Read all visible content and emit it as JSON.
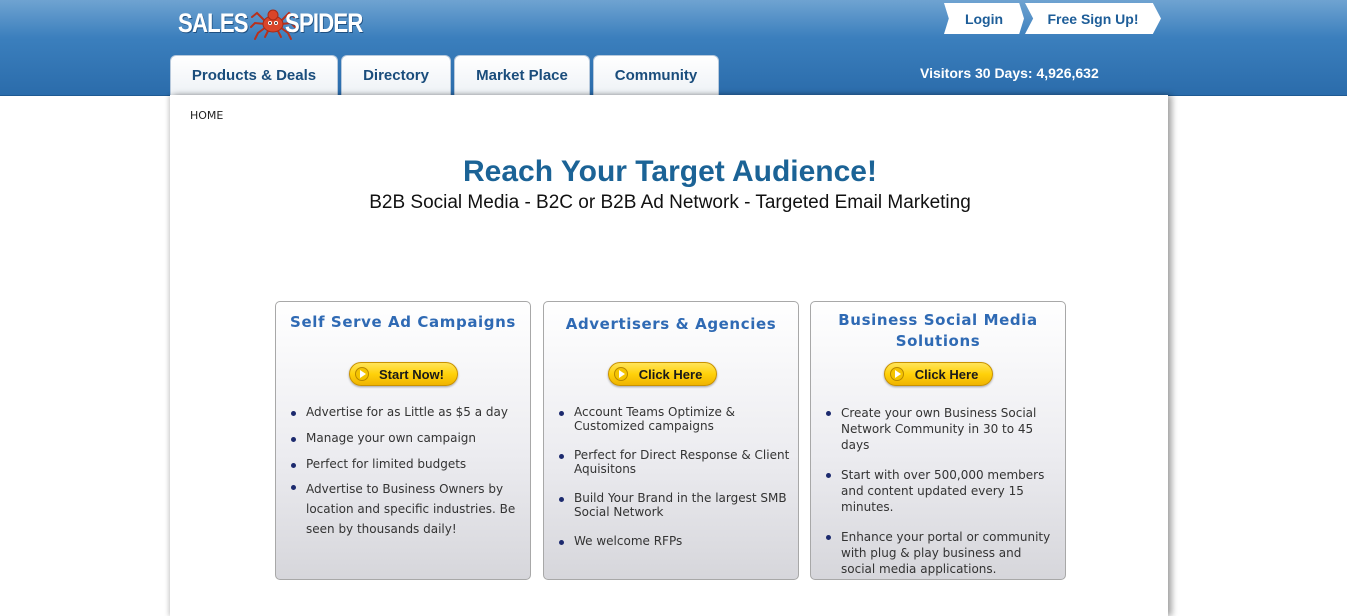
{
  "header": {
    "logo_left": "SALES",
    "logo_right": "SPIDER",
    "login_label": "Login",
    "signup_label": "Free Sign Up!",
    "visitors_text": "Visitors 30 Days: 4,926,632"
  },
  "nav": {
    "tabs": [
      {
        "label": "Products & Deals"
      },
      {
        "label": "Directory"
      },
      {
        "label": "Market Place"
      },
      {
        "label": "Community"
      }
    ]
  },
  "breadcrumb": "HOME",
  "hero": {
    "headline": "Reach Your Target Audience!",
    "subheadline": "B2B Social Media - B2C or B2B Ad Network - Targeted Email Marketing"
  },
  "cards": [
    {
      "title": "Self Serve Ad Campaigns",
      "button_label": "Start Now!",
      "items": [
        "Advertise for as Little as $5 a day",
        "Manage your own campaign",
        "Perfect for limited budgets",
        "Advertise to Business Owners by location and specific industries. Be seen by thousands daily!"
      ]
    },
    {
      "title": "Advertisers & Agencies",
      "button_label": "Click Here",
      "items": [
        "Account Teams Optimize & Customized campaigns",
        "Perfect for Direct Response & Client Aquisitons",
        "Build Your Brand in the largest SMB Social Network",
        "We welcome RFPs"
      ]
    },
    {
      "title": "Business Social Media Solutions",
      "button_label": "Click Here",
      "items": [
        "Create your own Business Social Network Community in 30 to 45 days",
        "Start with over 500,000 members and content updated every 15 minutes.",
        "Enhance your portal or community with plug & play business and  social media applications."
      ]
    }
  ],
  "colors": {
    "header_blue": "#2b6cab",
    "headline_blue": "#1b6396",
    "card_title_blue": "#2f6ab4",
    "button_yellow": "#ffd10a",
    "logo_spider_red": "#d9452a"
  }
}
